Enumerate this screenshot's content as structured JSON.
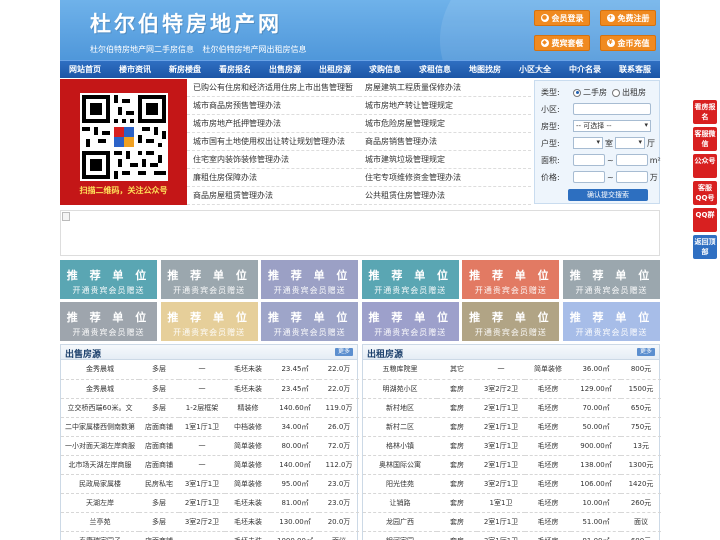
{
  "header": {
    "title": "杜尔伯特房地产网",
    "subtitle": "杜尔伯特房地产网二手房信息   杜尔伯特房地产网出租房信息",
    "buttons": [
      {
        "label": "会员登录",
        "icon": "user-icon"
      },
      {
        "label": "免费注册",
        "icon": "register-icon"
      },
      {
        "label": "费宾套餐",
        "icon": "package-icon"
      },
      {
        "label": "金币充值",
        "icon": "coin-icon"
      }
    ]
  },
  "nav": [
    "网站首页",
    "楼市资讯",
    "新房楼盘",
    "看房报名",
    "出售房源",
    "出租房源",
    "求购信息",
    "求租信息",
    "地图找房",
    "小区大全",
    "中介名录",
    "联系客服"
  ],
  "qr": {
    "caption": "扫描二维码，关注公众号"
  },
  "links": {
    "left": [
      "已购公有住房和经济适用住房上市出售管理暂",
      "城市商品房预售管理办法",
      "城市房地产抵押管理办法",
      "城市国有土地使用权出让转让规划管理办法",
      "住宅室内装饰装修管理办法",
      "廉租住房保障办法",
      "商品房屋租赁管理办法"
    ],
    "right": [
      "房屋建筑工程质量保修办法",
      "城市房地产转让管理规定",
      "城市危险房屋管理规定",
      "商品房销售管理办法",
      "城市建筑垃圾管理规定",
      "住宅专项维修资金管理办法",
      "公共租赁住房管理办法"
    ]
  },
  "search": {
    "type_label": "类型:",
    "type_options": [
      "二手房",
      "出租房"
    ],
    "community_label": "小区:",
    "house_type_label": "房型:",
    "house_type_value": "-- 可选择 --",
    "layout_label": "户型:",
    "room_unit": "室",
    "hall_unit": "厅",
    "area_label": "面积:",
    "area_sep": "~",
    "area_unit": "m²",
    "price_label": "价格:",
    "price_sep": "~",
    "price_unit": "万",
    "submit": "确认提交搜索"
  },
  "tiles": {
    "title": "推 荐 单 位",
    "subtitle": "开通贵宾会员赠送",
    "colors": [
      "#5aa6b3",
      "#9ba7ae",
      "#9ba0c5",
      "#5aa6b3",
      "#e27a63",
      "#9ba7ae",
      "#9ea5ad",
      "#e6cf9a",
      "#9ea5c9",
      "#9da0cb",
      "#b1a485",
      "#a7bde8"
    ]
  },
  "sale": {
    "title": "出售房源",
    "more": "更多",
    "rows": [
      [
        "金秀晨城",
        "多层",
        "一",
        "毛坯未装",
        "23.45㎡",
        "22.0万"
      ],
      [
        "金秀晨城",
        "多层",
        "一",
        "毛坯未装",
        "23.45㎡",
        "22.0万"
      ],
      [
        "立交桥西端60米。文",
        "多层",
        "1-2层框架",
        "精装修",
        "140.60㎡",
        "119.0万"
      ],
      [
        "二中家属楼西侧南数第",
        "店面商铺",
        "1室1厅1卫",
        "中档装修",
        "34.00㎡",
        "26.0万"
      ],
      [
        "一小对面天湖左岸商服",
        "店面商铺",
        "一",
        "简单装修",
        "80.00㎡",
        "72.0万"
      ],
      [
        "北市场天湖左岸商服",
        "店面商铺",
        "一",
        "简单装修",
        "140.00㎡",
        "112.0万"
      ],
      [
        "民政局家属楼",
        "民房私宅",
        "3室1厅1卫",
        "简单装修",
        "95.00㎡",
        "23.0万"
      ],
      [
        "天湖左岸",
        "多层",
        "2室1厅1卫",
        "毛坯未装",
        "81.00㎡",
        "23.0万"
      ],
      [
        "兰亭苑",
        "多层",
        "3室2厅2卫",
        "毛坯未装",
        "130.00㎡",
        "20.0万"
      ],
      [
        "泰康瑞家园子",
        "店面商铺",
        "一",
        "毛坯未装",
        "1000.00㎡",
        "面议"
      ]
    ]
  },
  "rent": {
    "title": "出租房源",
    "more": "更多",
    "rows": [
      [
        "五粮库院里",
        "其它",
        "一",
        "简单装修",
        "36.00㎡",
        "800元"
      ],
      [
        "明湖苑小区",
        "套房",
        "3室2厅2卫",
        "毛坯房",
        "129.00㎡",
        "1500元"
      ],
      [
        "新村地区",
        "套房",
        "2室1厅1卫",
        "毛坯房",
        "70.00㎡",
        "650元"
      ],
      [
        "新村二区",
        "套房",
        "2室1厅1卫",
        "毛坯房",
        "50.00㎡",
        "750元"
      ],
      [
        "格林小镇",
        "套房",
        "3室1厅1卫",
        "毛坯房",
        "900.00㎡",
        "13元"
      ],
      [
        "奥林国际公寓",
        "套房",
        "2室1厅1卫",
        "毛坯房",
        "138.00㎡",
        "1300元"
      ],
      [
        "阳光佳苑",
        "套房",
        "3室2厅1卫",
        "毛坯房",
        "106.00㎡",
        "1420元"
      ],
      [
        "让销路",
        "套房",
        "1室1卫",
        "毛坯房",
        "10.00㎡",
        "260元"
      ],
      [
        "龙园广西",
        "套房",
        "2室1厅1卫",
        "毛坯房",
        "51.00㎡",
        "面议"
      ],
      [
        "银河家园",
        "套房",
        "3室1厅1卫",
        "毛坯房",
        "91.00㎡",
        "600元"
      ]
    ]
  },
  "floatbar": [
    "看房报名",
    "客服微信",
    "公众号",
    "客服QQ号",
    "QQ群",
    "返回顶部"
  ]
}
